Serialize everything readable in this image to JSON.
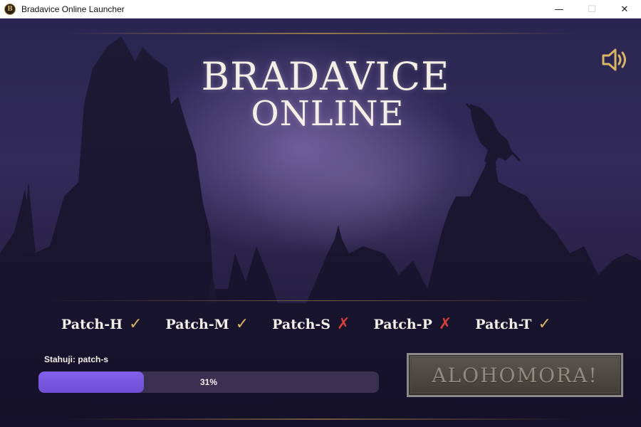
{
  "window": {
    "title": "Bradavice Online Launcher",
    "icon_letter": "B",
    "minimize": "—",
    "maximize": "☐",
    "close": "✕"
  },
  "logo": {
    "line1": "BRADAVICE",
    "line2": "ONLINE"
  },
  "sound": {
    "icon": "speaker-icon",
    "color": "#d8b564"
  },
  "patches": [
    {
      "name": "Patch-H",
      "status": "ok",
      "mark": "✓"
    },
    {
      "name": "Patch-M",
      "status": "ok",
      "mark": "✓"
    },
    {
      "name": "Patch-S",
      "status": "fail",
      "mark": "✗"
    },
    {
      "name": "Patch-P",
      "status": "fail",
      "mark": "✗"
    },
    {
      "name": "Patch-T",
      "status": "ok",
      "mark": "✓"
    }
  ],
  "download": {
    "status_text": "Stahuji: patch-s",
    "progress_percent": 31,
    "progress_label": "31%",
    "fill_color": "#7b5ae3"
  },
  "play_button": {
    "label": "ALOHOMORA!"
  },
  "colors": {
    "accent_gold": "#d8b564",
    "fail_red": "#d2403a",
    "text_light": "#f2eee8"
  }
}
